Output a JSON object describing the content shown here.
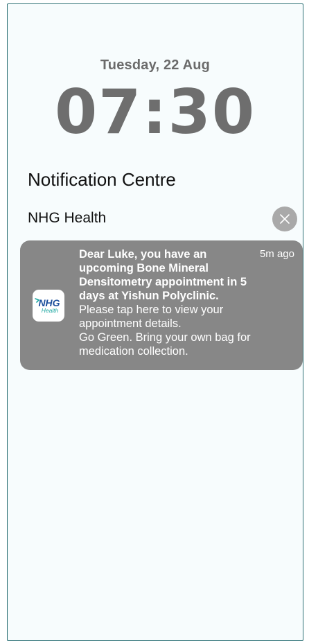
{
  "lockscreen": {
    "date": "Tuesday, 22 Aug",
    "time": "07:30"
  },
  "notification_centre": {
    "title": "Notification Centre",
    "group": {
      "app_name": "NHG Health",
      "clear_icon": "close-icon"
    },
    "notification": {
      "logo": {
        "text_top": "NHG",
        "text_bottom": "Health",
        "brand_color": "#1b4f9c",
        "accent_color": "#1aa6a0"
      },
      "time_ago": "5m ago",
      "bold_lines": [
        "Dear Luke, you have an",
        "upcoming Bone Mineral",
        "Densitometry appointment in 5",
        "days at Yishun Polyclinic."
      ],
      "regular_lines": [
        "Please tap here to view your",
        "appointment details.",
        "Go Green. Bring your own bag for",
        "medication collection."
      ]
    }
  },
  "colors": {
    "frame_border": "#2a6f73",
    "card_background": "#878787",
    "clear_button": "#a9a9a9",
    "time_text": "#6e6e6e"
  }
}
